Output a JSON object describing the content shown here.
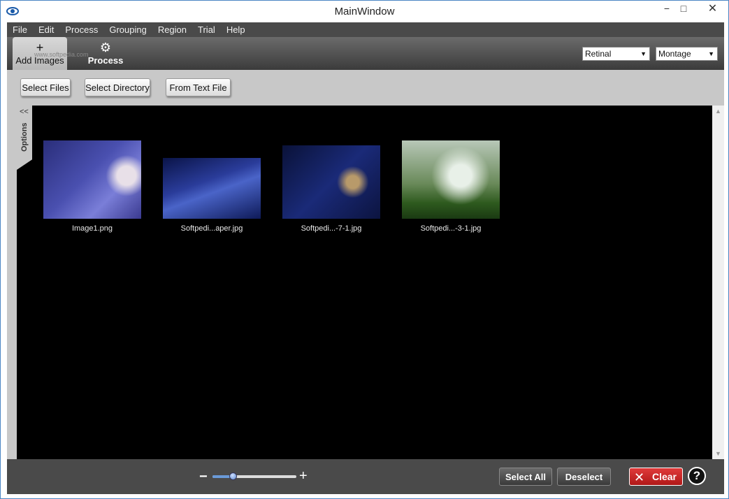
{
  "window": {
    "title": "MainWindow",
    "minimize": "−",
    "maximize": "□",
    "close": "✕"
  },
  "menu": [
    "File",
    "Edit",
    "Process",
    "Grouping",
    "Region",
    "Trial",
    "Help"
  ],
  "toolbar": {
    "add_images_label": "Add Images",
    "add_images_icon": "+",
    "process_label": "Process",
    "process_icon": "⚙",
    "watermark": "www.softpedia.com",
    "region_select": "Retinal",
    "grouping_select": "Montage"
  },
  "subbar": {
    "select_files": "Select Files",
    "select_directory": "Select Directory",
    "from_text_file": "From Text File"
  },
  "options_panel": {
    "collapse_icon": "<<",
    "label": "Options"
  },
  "thumbnails": [
    {
      "label": "Image1.png"
    },
    {
      "label": "Softpedi...aper.jpg"
    },
    {
      "label": "Softpedi...-7-1.jpg"
    },
    {
      "label": "Softpedi...-3-1.jpg"
    }
  ],
  "bottombar": {
    "zoom_minus": "−",
    "zoom_plus": "+",
    "zoom_level": 0.24,
    "select_all": "Select All",
    "deselect": "Deselect",
    "clear": "Clear",
    "help": "?"
  },
  "colors": {
    "clear_red": "#c82222",
    "toolbar_dark": "#4a4a4a",
    "panel_gray": "#c8c8c8"
  }
}
